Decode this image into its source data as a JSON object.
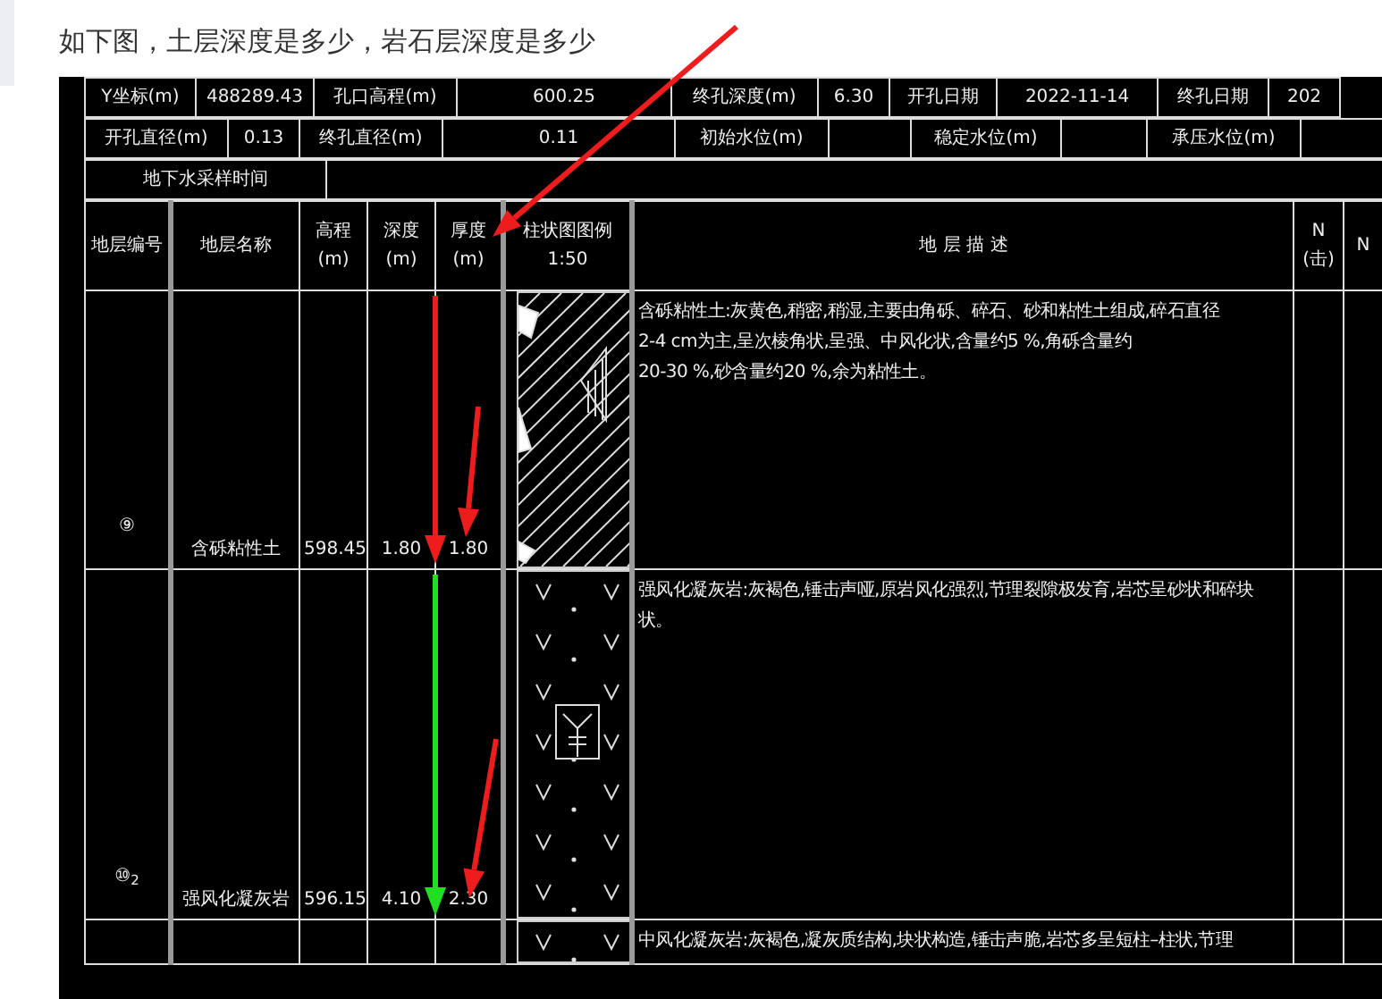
{
  "question": "如下图，土层深度是多少，岩石层深度是多少",
  "info_rows": [
    [
      {
        "label": "Y坐标(m)",
        "value": "488289.43"
      },
      {
        "label": "孔口高程(m)",
        "value": "600.25"
      },
      {
        "label": "终孔深度(m)",
        "value": "6.30"
      },
      {
        "label": "开孔日期",
        "value": "2022-11-14"
      },
      {
        "label": "终孔日期",
        "value": "202"
      }
    ],
    [
      {
        "label": "开孔直径(m)",
        "value": "0.13"
      },
      {
        "label": "终孔直径(m)",
        "value": "0.11"
      },
      {
        "label": "初始水位(m)"
      },
      {
        "label": "稳定水位(m)"
      },
      {
        "label": "承压水位(m)"
      }
    ],
    [
      {
        "label": "地下水采样时间"
      }
    ]
  ],
  "columns": [
    {
      "label": "地层编号"
    },
    {
      "label": "地层名称"
    },
    {
      "label": "高程",
      "unit": "(m)"
    },
    {
      "label": "深度",
      "unit": "(m)"
    },
    {
      "label": "厚度",
      "unit": "(m)"
    },
    {
      "label": "柱状图图例",
      "unit": "1:50"
    },
    {
      "label": "地 层 描 述"
    },
    {
      "label": "N",
      "unit": "(击)"
    },
    {
      "label": "N"
    }
  ],
  "layers": [
    {
      "kind": "soil",
      "number": "⑨",
      "name": "含砾粘性土",
      "elevation": "598.45",
      "depth": "1.80",
      "thickness": "1.80",
      "description": [
        "含砾粘性土:灰黄色,稍密,稍湿,主要由角砾、碎石、砂和粘性土组成,碎石直径",
        "2-4 cm为主,呈次棱角状,呈强、中风化状,含量约5 %,角砾含量约",
        "20-30 %,砂含量约20 %,余为粘性土。"
      ]
    },
    {
      "kind": "rock",
      "number": "⑩$_{2}$",
      "name": "强风化凝灰岩",
      "elevation": "596.15",
      "depth": "4.10",
      "thickness": "2.30",
      "description": [
        "强风化凝灰岩:灰褐色,锤击声哑,原岩风化强烈,节理裂隙极发育,岩芯呈砂状和碎块",
        "状。"
      ]
    },
    {
      "kind": "rock",
      "description": [
        "中风化凝灰岩:灰褐色,凝灰质结构,块状构造,锤击声脆,岩芯多呈短柱–柱状,节理"
      ]
    }
  ],
  "annotations": [
    {
      "color": "#ee1c1c"
    },
    {
      "color": "#ee1c1c"
    },
    {
      "color": "#ee1c1c"
    },
    {
      "color": "#22dd22"
    },
    {
      "color": "#ee1c1c"
    }
  ]
}
